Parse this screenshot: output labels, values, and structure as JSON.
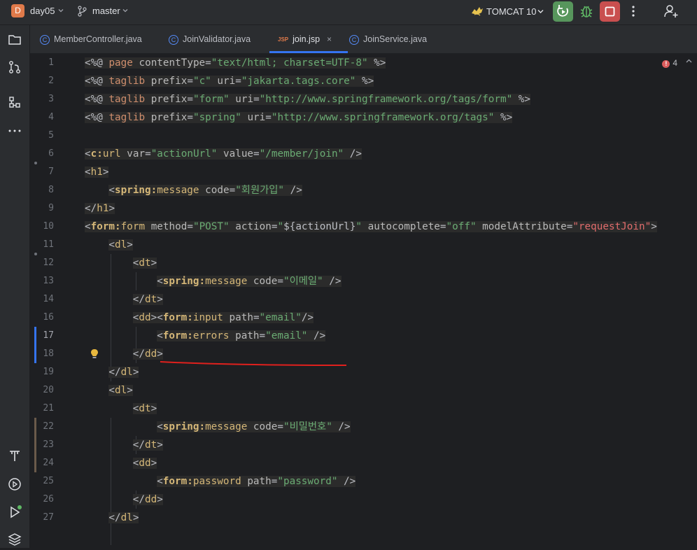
{
  "titlebar": {
    "project_badge": "D",
    "project_name": "day05",
    "branch": "master",
    "run_config": "TOMCAT 10"
  },
  "tabs": [
    {
      "label": "MemberController.java",
      "type": "java"
    },
    {
      "label": "JoinValidator.java",
      "type": "java"
    },
    {
      "label": "join.jsp",
      "type": "jsp",
      "badge": "JSP",
      "active": true,
      "close": "×"
    },
    {
      "label": "JoinService.java",
      "type": "java"
    }
  ],
  "editor": {
    "error_count": "4",
    "error_symbol": "!",
    "line_numbers": [
      "1",
      "2",
      "3",
      "4",
      "5",
      "6",
      "7",
      "8",
      "9",
      "10",
      "11",
      "12",
      "13",
      "14",
      "16",
      "17",
      "18",
      "19",
      "20",
      "21",
      "22",
      "23",
      "24",
      "25",
      "26",
      "27"
    ],
    "current_line": "17"
  },
  "code": {
    "l1": [
      "<%@ ",
      "page",
      " contentType",
      "=",
      "\"text/html; charset=UTF-8\"",
      " %>"
    ],
    "l2": [
      "<%@ ",
      "taglib",
      " prefix",
      "=",
      "\"c\"",
      " uri",
      "=",
      "\"jakarta.tags.core\"",
      " %>"
    ],
    "l3": [
      "<%@ ",
      "taglib",
      " prefix",
      "=",
      "\"form\"",
      " uri",
      "=",
      "\"http://www.springframework.org/tags/form\"",
      " %>"
    ],
    "l4": [
      "<%@ ",
      "taglib",
      " prefix",
      "=",
      "\"spring\"",
      " uri",
      "=",
      "\"http://www.springframework.org/tags\"",
      " %>"
    ],
    "l6": [
      "<",
      "c:url",
      " var",
      "=",
      "\"actionUrl\"",
      " value",
      "=",
      "\"/member/join\"",
      " />"
    ],
    "l7": [
      "<",
      "h1",
      ">"
    ],
    "l8": [
      "<",
      "spring:message",
      " code",
      "=",
      "\"회원가입\"",
      " />"
    ],
    "l9": [
      "</",
      "h1",
      ">"
    ],
    "l10": [
      "<",
      "form:form",
      " method",
      "=",
      "\"POST\"",
      " action",
      "=",
      "\"${actionUrl}\"",
      " autocomplete",
      "=",
      "\"off\"",
      " modelAttribute",
      "=",
      "\"requestJoin\"",
      ">"
    ],
    "l11": [
      "<",
      "dl",
      ">"
    ],
    "l12": [
      "<",
      "dt",
      ">"
    ],
    "l13": [
      "<",
      "spring:message",
      " code",
      "=",
      "\"이메일\"",
      " />"
    ],
    "l14": [
      "</",
      "dt",
      ">"
    ],
    "l15": [
      "<",
      "dd",
      ">"
    ],
    "l16": [
      "<",
      "form:input",
      " path",
      "=",
      "\"email\"",
      "/>"
    ],
    "l17": [
      "<",
      "form:errors",
      " path",
      "=",
      "\"email\"",
      " />"
    ],
    "l18": [
      "</",
      "dd",
      ">"
    ],
    "l19": [
      "</",
      "dl",
      ">"
    ],
    "l20": [
      "<",
      "dl",
      ">"
    ],
    "l21": [
      "<",
      "dt",
      ">"
    ],
    "l22": [
      "<",
      "spring:message",
      " code",
      "=",
      "\"비밀번호\"",
      " />"
    ],
    "l23": [
      "</",
      "dt",
      ">"
    ],
    "l24": [
      "<",
      "dd",
      ">"
    ],
    "l25": [
      "<",
      "form:password",
      " path",
      "=",
      "\"password\"",
      " />"
    ],
    "l26": [
      "</",
      "dd",
      ">"
    ],
    "l27": [
      "</",
      "dl",
      ">"
    ]
  },
  "colors": {
    "accent": "#3574f0",
    "run": "#57965c",
    "stop": "#c94f4f",
    "error": "#db5c5c",
    "annotation_underline": "#e0201d"
  },
  "icons": {
    "toolstrip": [
      "folder-icon",
      "commit-icon",
      "structure-icon",
      "more-icon",
      "font-icon",
      "services-icon",
      "run-icon",
      "layers-icon"
    ]
  }
}
